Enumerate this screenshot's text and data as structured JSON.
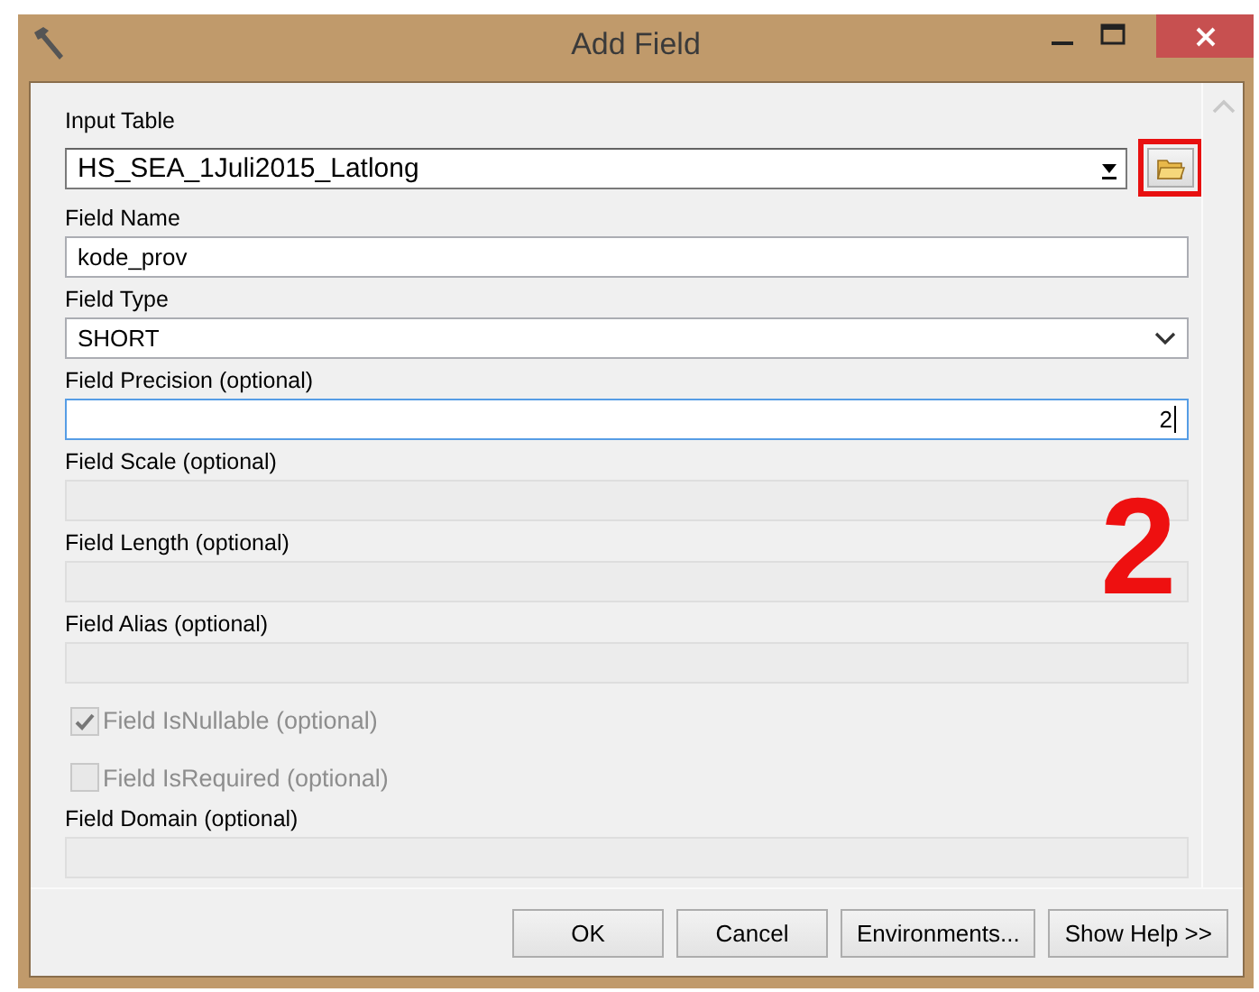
{
  "window": {
    "title": "Add Field"
  },
  "fields": [
    {
      "kind": "combo",
      "label": "Input Table",
      "value": "HS_SEA_1Juli2015_Latlong",
      "disabled": false,
      "focused": false,
      "browse_highlighted": true
    },
    {
      "kind": "text",
      "label": "Field Name",
      "value": "kode_prov",
      "disabled": false,
      "focused": false,
      "numeric": false
    },
    {
      "kind": "select",
      "label": "Field Type",
      "value": "SHORT",
      "disabled": false,
      "focused": false
    },
    {
      "kind": "text",
      "label": "Field Precision (optional)",
      "value": "2",
      "disabled": false,
      "focused": true,
      "numeric": true
    },
    {
      "kind": "text",
      "label": "Field Scale (optional)",
      "disabled": true,
      "focused": false,
      "numeric": true
    },
    {
      "kind": "text",
      "label": "Field Length (optional)",
      "disabled": true,
      "focused": false,
      "numeric": true
    },
    {
      "kind": "text",
      "label": "Field Alias (optional)",
      "disabled": true,
      "focused": false,
      "numeric": false
    },
    {
      "kind": "checkbox",
      "label": "Field IsNullable (optional)",
      "checked": true,
      "disabled": true
    },
    {
      "kind": "checkbox",
      "label": "Field IsRequired (optional)",
      "checked": false,
      "disabled": true
    },
    {
      "kind": "text",
      "label": "Field Domain (optional)",
      "disabled": true,
      "focused": false,
      "numeric": false
    }
  ],
  "annotation": {
    "text": "2"
  },
  "buttons": [
    "OK",
    "Cancel",
    "Environments...",
    "Show Help >>"
  ]
}
